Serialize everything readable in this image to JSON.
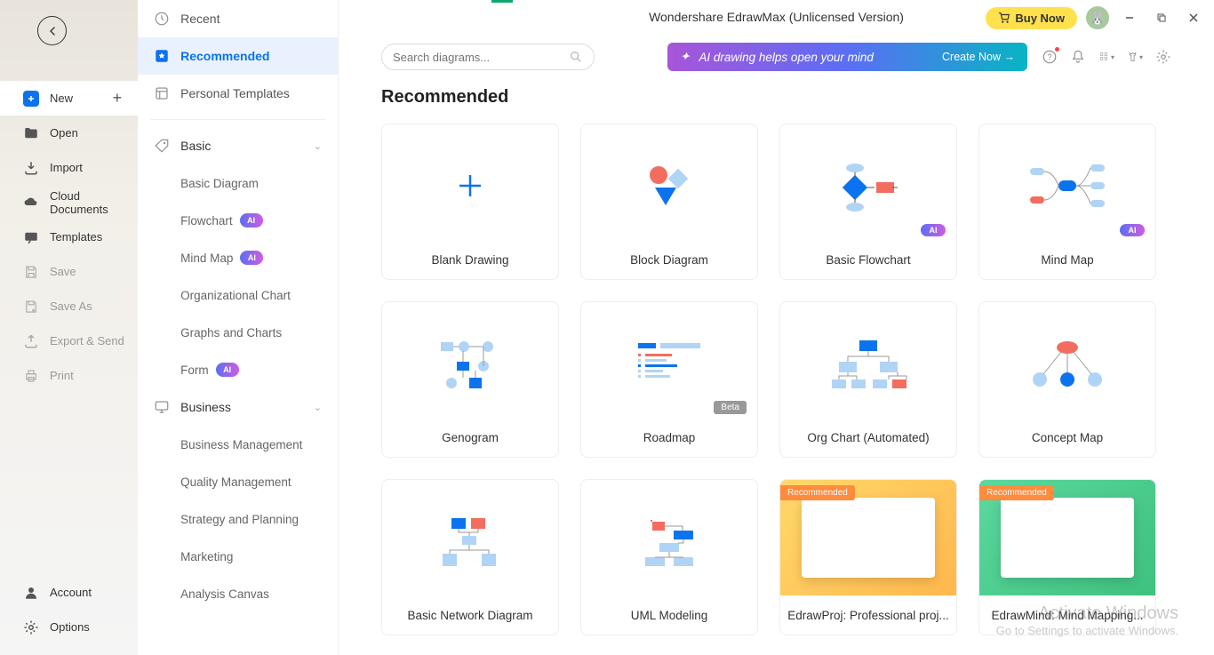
{
  "window": {
    "title": "Wondershare EdrawMax (Unlicensed Version)",
    "buy_label": "Buy Now"
  },
  "sidebar_narrow": {
    "items": [
      {
        "label": "New",
        "icon": "plus-square",
        "active": true,
        "has_add": true
      },
      {
        "label": "Open",
        "icon": "folder"
      },
      {
        "label": "Import",
        "icon": "download"
      },
      {
        "label": "Cloud Documents",
        "icon": "cloud"
      },
      {
        "label": "Templates",
        "icon": "chat"
      },
      {
        "label": "Save",
        "icon": "save",
        "disabled": true
      },
      {
        "label": "Save As",
        "icon": "save-as",
        "disabled": true
      },
      {
        "label": "Export & Send",
        "icon": "export",
        "disabled": true
      },
      {
        "label": "Print",
        "icon": "print",
        "disabled": true
      }
    ],
    "footer": [
      {
        "label": "Account",
        "icon": "user"
      },
      {
        "label": "Options",
        "icon": "gear"
      }
    ]
  },
  "sidebar_cat": {
    "top": [
      {
        "label": "Recent",
        "icon": "clock"
      },
      {
        "label": "Recommended",
        "icon": "star",
        "active": true
      },
      {
        "label": "Personal Templates",
        "icon": "template"
      }
    ],
    "groups": [
      {
        "label": "Basic",
        "icon": "tag",
        "items": [
          {
            "label": "Basic Diagram"
          },
          {
            "label": "Flowchart",
            "ai": true
          },
          {
            "label": "Mind Map",
            "ai": true
          },
          {
            "label": "Organizational Chart"
          },
          {
            "label": "Graphs and Charts"
          },
          {
            "label": "Form",
            "ai": true
          }
        ]
      },
      {
        "label": "Business",
        "icon": "monitor",
        "items": [
          {
            "label": "Business Management"
          },
          {
            "label": "Quality Management"
          },
          {
            "label": "Strategy and Planning"
          },
          {
            "label": "Marketing"
          },
          {
            "label": "Analysis Canvas"
          }
        ]
      }
    ]
  },
  "search": {
    "placeholder": "Search diagrams..."
  },
  "ai_banner": {
    "text": "AI drawing helps open your mind",
    "cta": "Create Now →"
  },
  "section_title": "Recommended",
  "cards": [
    {
      "label": "Blank Drawing",
      "type": "plus"
    },
    {
      "label": "Block Diagram",
      "type": "shapes"
    },
    {
      "label": "Basic Flowchart",
      "type": "flow",
      "ai": true
    },
    {
      "label": "Mind Map",
      "type": "mind",
      "ai": true
    },
    {
      "label": "Genogram",
      "type": "geno"
    },
    {
      "label": "Roadmap",
      "type": "road",
      "beta": true
    },
    {
      "label": "Org Chart (Automated)",
      "type": "org"
    },
    {
      "label": "Concept Map",
      "type": "concept"
    },
    {
      "label": "Basic Network Diagram",
      "type": "network"
    },
    {
      "label": "UML Modeling",
      "type": "uml"
    },
    {
      "label": "EdrawProj: Professional proj...",
      "type": "promo-orange",
      "recommended": true
    },
    {
      "label": "EdrawMind: Mind Mapping...",
      "type": "promo-green",
      "recommended": true
    }
  ],
  "badges": {
    "ai": "AI",
    "beta": "Beta",
    "recommended": "Recommended"
  },
  "watermark": {
    "line1": "Activate Windows",
    "line2": "Go to Settings to activate Windows."
  }
}
